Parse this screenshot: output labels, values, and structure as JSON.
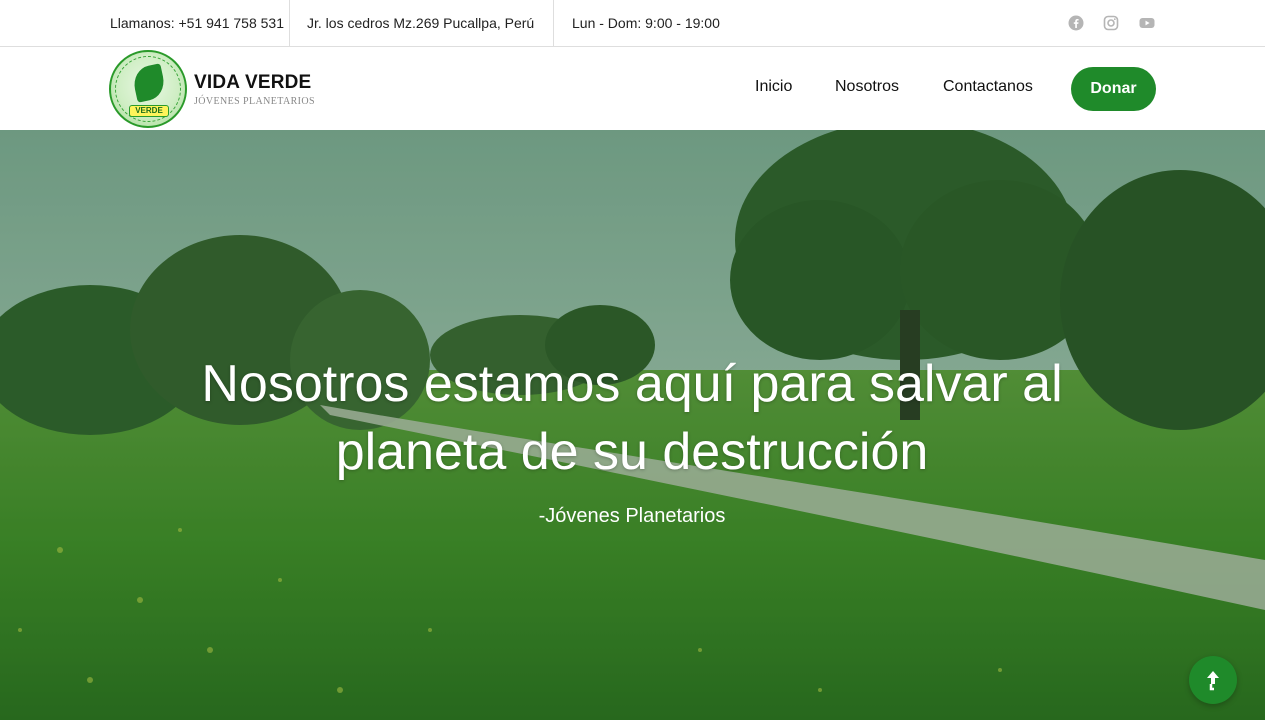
{
  "topbar": {
    "phone": "Llamanos: +51 941 758 531",
    "address": "Jr. los cedros Mz.269 Pucallpa, Perú",
    "hours": "Lun - Dom: 9:00 - 19:00",
    "social_icons": [
      "facebook-icon",
      "instagram-icon",
      "youtube-icon"
    ]
  },
  "brand": {
    "name": "VIDA VERDE",
    "subtitle": "JÓVENES PLANETARIOS",
    "badge": "VERDE"
  },
  "nav": {
    "items": [
      "Inicio",
      "Nosotros",
      "Contactanos"
    ],
    "cta": "Donar"
  },
  "hero": {
    "headline_line1": "Nosotros estamos aquí para salvar al",
    "headline_line2": "planeta de su destrucción",
    "tagline": "-Jóvenes Planetarios"
  },
  "colors": {
    "accent": "#1f8a2a",
    "topbar_text": "#222222",
    "icon_gray": "#b5b5b5"
  },
  "scroll_top": {
    "icon": "arrow-up-icon"
  }
}
